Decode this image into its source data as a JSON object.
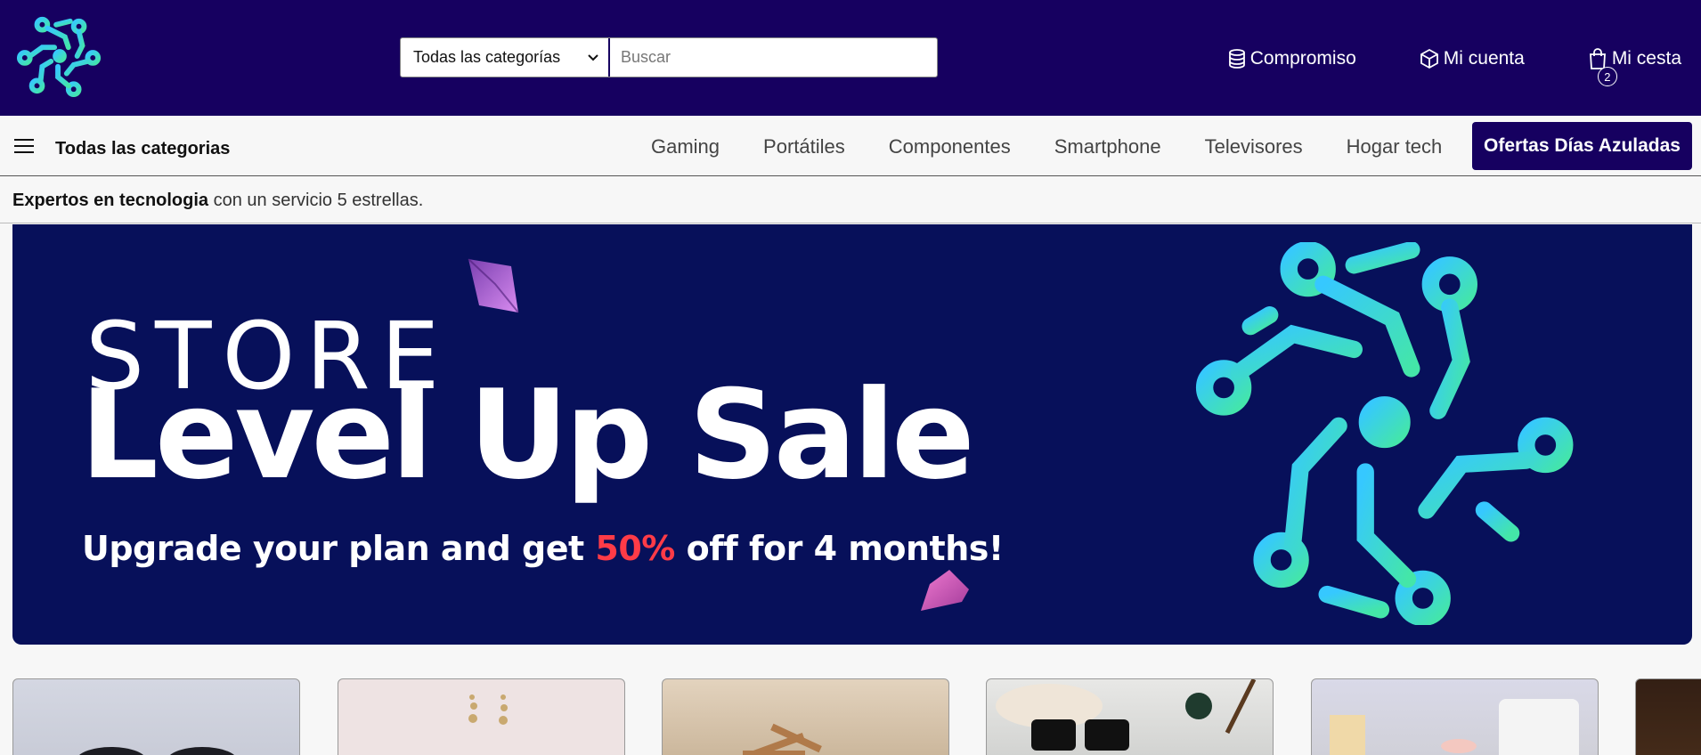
{
  "header": {
    "search": {
      "category_selected": "Todas las categorías",
      "placeholder": "Buscar"
    },
    "links": [
      {
        "label": "Compromiso",
        "icon": "database-icon"
      },
      {
        "label": "Mi cuenta",
        "icon": "box-icon"
      },
      {
        "label": "Mi cesta",
        "icon": "shopping-bag-icon"
      }
    ],
    "cart_count": "2"
  },
  "category_bar": {
    "all_label": "Todas las categorias",
    "items": [
      "Gaming",
      "Portátiles",
      "Componentes",
      "Smartphone",
      "Televisores",
      "Hogar tech"
    ],
    "offers_label": "Ofertas Días Azuladas"
  },
  "tagline": {
    "bold": "Expertos en tecnologia",
    "rest": " con un servicio 5 estrellas."
  },
  "banner": {
    "store": "STORE",
    "headline": "Level Up Sale",
    "sub_before": "Upgrade your plan and get ",
    "sub_highlight": "50%",
    "sub_after": " off for 4 months!"
  },
  "colors": {
    "header_bg": "#160060",
    "banner_bg": "#07105a",
    "highlight_red": "#ff3b47",
    "logo_gradient_start": "#36c8ff",
    "logo_gradient_end": "#44e6a8"
  },
  "product_tiles": [
    {
      "icon": "headphones-image"
    },
    {
      "icon": "earrings-image"
    },
    {
      "icon": "toy-image"
    },
    {
      "icon": "sunglasses-image"
    },
    {
      "icon": "mug-image"
    },
    {
      "icon": "product-image"
    }
  ]
}
